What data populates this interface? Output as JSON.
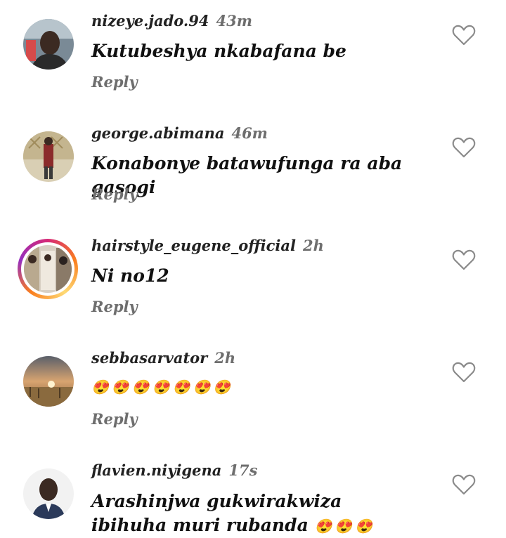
{
  "comments": [
    {
      "username": "nizeye.jado.94",
      "time": "43m",
      "text": "Kutubeshya nkabafana be",
      "reply": "Reply"
    },
    {
      "username": "george.abimana",
      "time": "46m",
      "text": "Konabonye batawufunga ra aba gasogi",
      "reply": "Reply"
    },
    {
      "username": "hairstyle_eugene_official",
      "time": "2h",
      "text": "Ni no12",
      "reply": "Reply"
    },
    {
      "username": "sebbasarvator",
      "time": "2h",
      "text": "😍😍😍😍😍😍😍",
      "reply": "Reply"
    },
    {
      "username": "flavien.niyigena",
      "time": "17s",
      "text": "Arashinjwa gukwirakwiza ibihuha muri rubanda",
      "text_suffix": "😍😍😍",
      "reply": ""
    }
  ],
  "colors": {
    "emoji": "#e81bb5",
    "muted": "#6e6e6e"
  },
  "icons": {
    "like": "heart-outline-icon"
  }
}
